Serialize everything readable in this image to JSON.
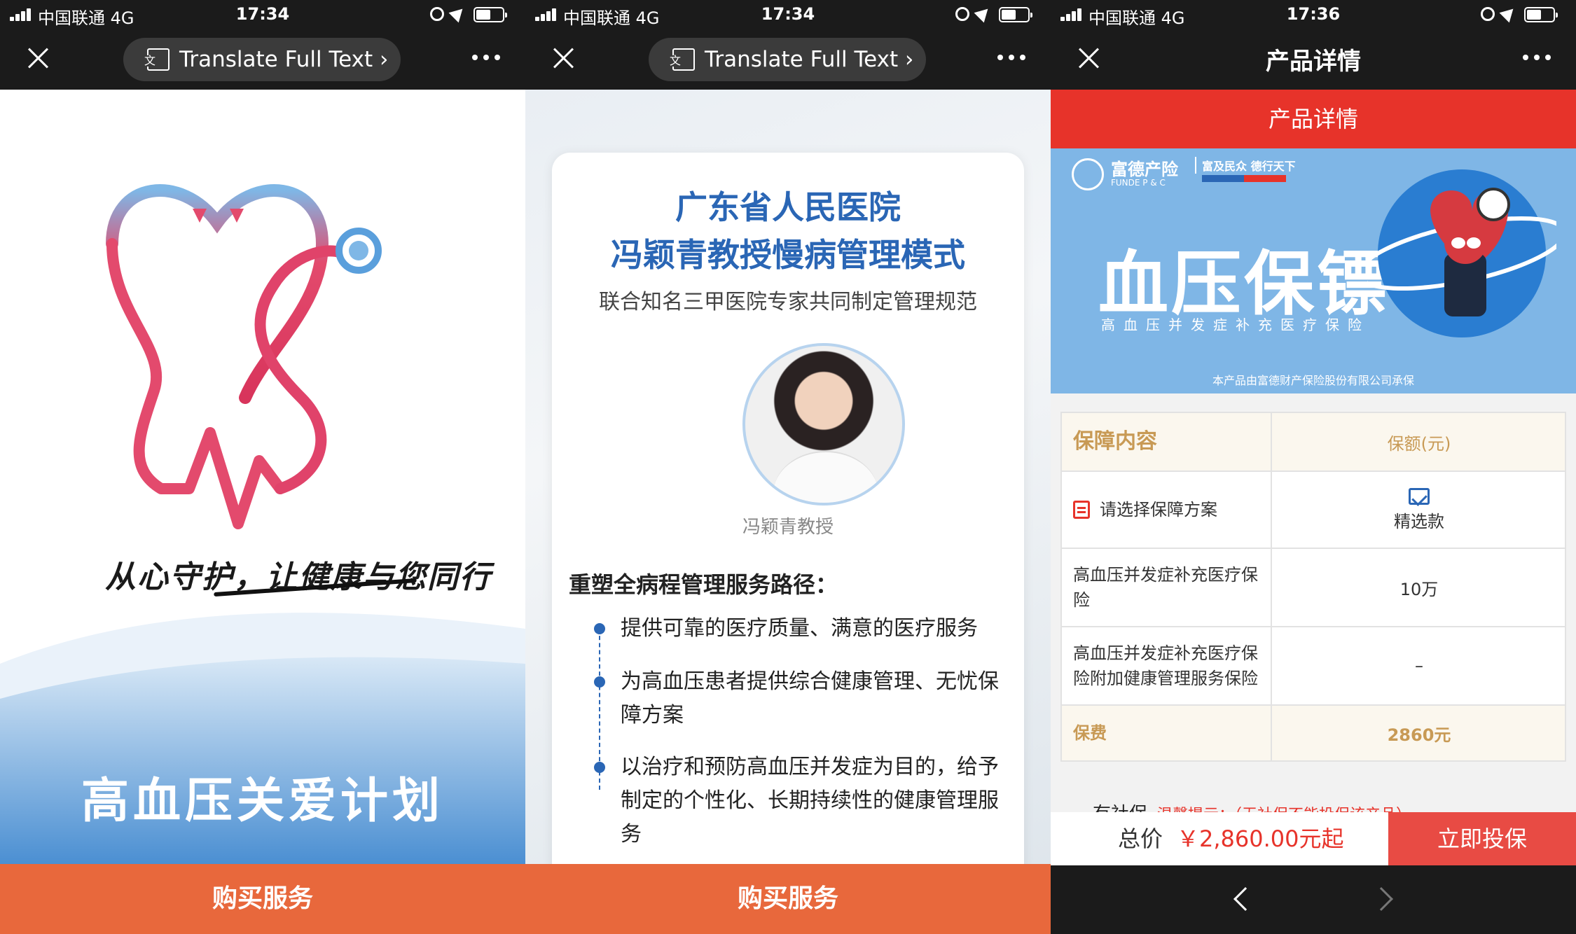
{
  "screens": [
    {
      "status": {
        "carrier": "中国联通  4G",
        "time": "17:34"
      },
      "nav": {
        "translate_label": "Translate Full Text ›"
      },
      "slogan": "从心守护，让健康与您同行",
      "title": "高血压关爱计划",
      "buy_label": "购买服务"
    },
    {
      "status": {
        "carrier": "中国联通  4G",
        "time": "17:34"
      },
      "nav": {
        "translate_label": "Translate Full Text ›"
      },
      "card": {
        "title_line1": "广东省人民医院",
        "title_line2": "冯颖青教授慢病管理模式",
        "subtitle": "联合知名三甲医院专家共同制定管理规范",
        "doctor_name": "冯颖青教授",
        "section_heading": "重塑全病程管理服务路径：",
        "bullets": [
          "提供可靠的医疗质量、满意的医疗服务",
          "为高血压患者提供综合健康管理、无忧保障方案",
          "以治疗和预防高血压并发症为目的，给予制定的个性化、长期持续性的健康管理服务"
        ]
      },
      "buy_label": "购买服务"
    },
    {
      "status": {
        "carrier": "中国联通  4G",
        "time": "17:36"
      },
      "nav": {
        "title": "产品详情"
      },
      "header": "产品详情",
      "banner": {
        "brand_name": "富德产险",
        "brand_sub": "FUNDE P & C",
        "brand_slogan": "富及民众 德行天下",
        "title": "血压保镖",
        "subtitle": "高血压并发症补充医疗保险",
        "note": "本产品由富德财产保险股份有限公司承保"
      },
      "table": {
        "head": {
          "left": "保障内容",
          "right": "保额(元)"
        },
        "plan": {
          "left": "请选择保障方案",
          "right": "精选款"
        },
        "rows": [
          {
            "left": "高血压并发症补充医疗保险",
            "right": "10万"
          },
          {
            "left": "高血压并发症补充医疗保险附加健康管理服务保险",
            "right": "–"
          }
        ],
        "fee": {
          "left": "保费",
          "right": "2860元"
        }
      },
      "hint": {
        "label": "有社保",
        "warning": "温馨提示：（无社保不能投保该产品）"
      },
      "bottom": {
        "total_label": "总价",
        "total_value": "￥2,860.00元起",
        "insure_label": "立即投保"
      }
    }
  ],
  "colors": {
    "accent_orange": "#e8683c",
    "accent_red": "#e7332a",
    "title_blue": "#2a66b5",
    "gold": "#c89a55"
  }
}
